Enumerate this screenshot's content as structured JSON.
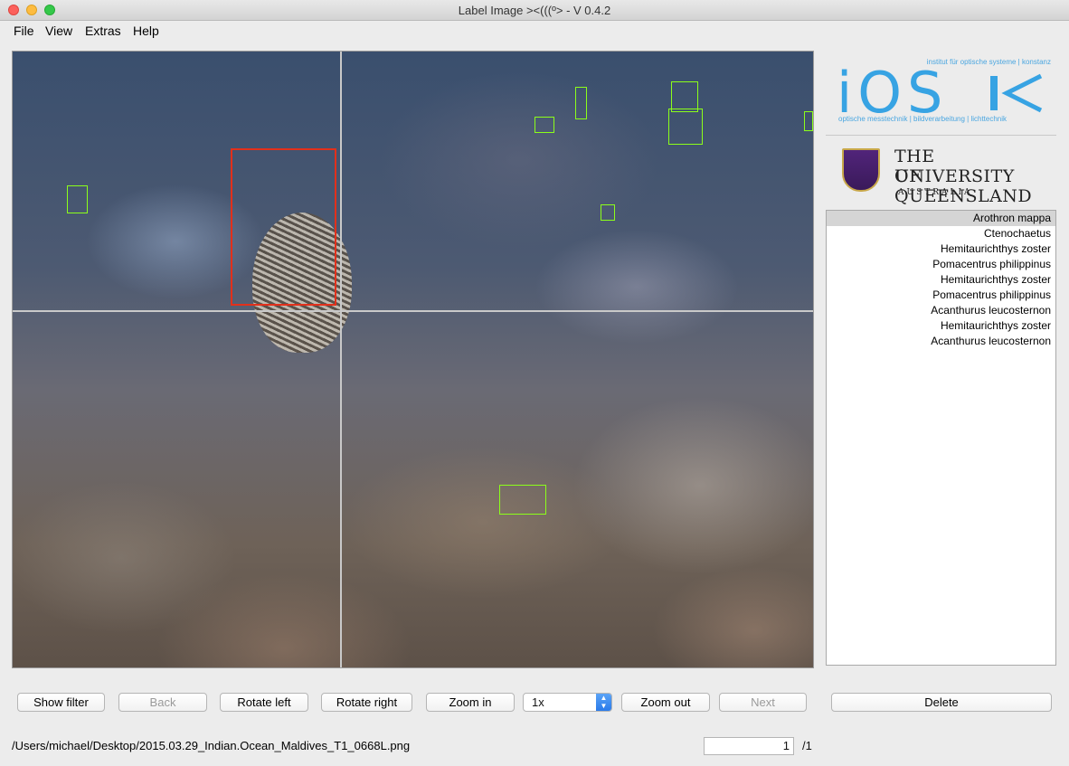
{
  "window": {
    "title": "Label Image ><(((º> - V 0.4.2"
  },
  "menu": [
    "File",
    "View",
    "Extras",
    "Help"
  ],
  "logos": {
    "ios": {
      "top_text": "institut für optische systeme | konstanz",
      "big_text": "iOS",
      "bottom_text": "optische messtechnik | bildverarbeitung | lichttechnik"
    },
    "uq": {
      "line1": "THE UNIVERSITY",
      "line2": "OF QUEENSLAND",
      "line3": "AUSTRALIA"
    }
  },
  "labels": [
    {
      "text": "Arothron mappa",
      "selected": true
    },
    {
      "text": "Ctenochaetus",
      "selected": false
    },
    {
      "text": "Hemitaurichthys zoster",
      "selected": false
    },
    {
      "text": "Pomacentrus philippinus",
      "selected": false
    },
    {
      "text": "Hemitaurichthys zoster",
      "selected": false
    },
    {
      "text": "Pomacentrus philippinus",
      "selected": false
    },
    {
      "text": "Acanthurus leucosternon",
      "selected": false
    },
    {
      "text": "Hemitaurichthys zoster",
      "selected": false
    },
    {
      "text": "Acanthurus leucosternon",
      "selected": false
    }
  ],
  "toolbar": {
    "show_filter": "Show filter",
    "back": "Back",
    "rotate_left": "Rotate left",
    "rotate_right": "Rotate right",
    "zoom_in": "Zoom in",
    "zoom_value": "1x",
    "zoom_out": "Zoom out",
    "next": "Next",
    "delete": "Delete"
  },
  "status": {
    "file_path": "/Users/michael/Desktop/2015.03.29_Indian.Ocean_Maldives_T1_0668L.png",
    "page_current": "1",
    "page_total": "/1"
  },
  "colors": {
    "bbox_default": "#8cff1a",
    "bbox_selected": "#e2301b",
    "ios_blue": "#37a3e3"
  }
}
